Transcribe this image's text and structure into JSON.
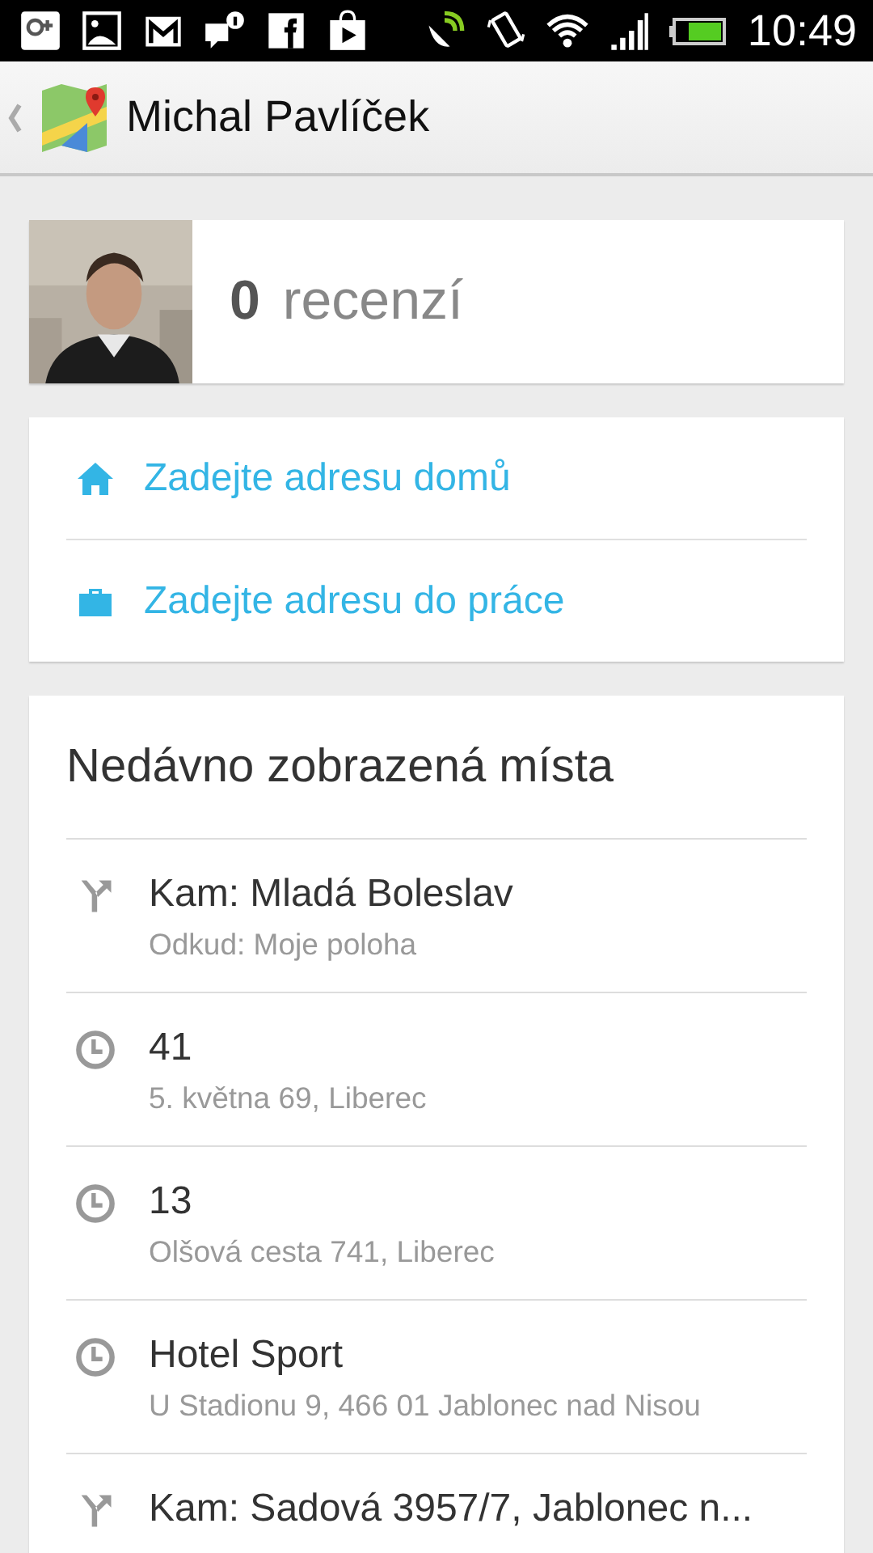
{
  "status_bar": {
    "time": "10:49"
  },
  "action_bar": {
    "title": "Michal Pavlíček"
  },
  "profile": {
    "review_count": "0",
    "review_label": "recenzí"
  },
  "address_links": [
    {
      "kind": "home",
      "label": "Zadejte adresu domů"
    },
    {
      "kind": "work",
      "label": "Zadejte adresu do práce"
    }
  ],
  "recent": {
    "heading": "Nedávno zobrazená místa",
    "items": [
      {
        "kind": "directions",
        "title": "Kam: Mladá Boleslav",
        "subtitle": "Odkud: Moje poloha"
      },
      {
        "kind": "history",
        "title": "41",
        "subtitle": "5. května 69, Liberec"
      },
      {
        "kind": "history",
        "title": "13",
        "subtitle": "Olšová cesta 741, Liberec"
      },
      {
        "kind": "history",
        "title": "Hotel Sport",
        "subtitle": "U Stadionu 9, 466 01 Jablonec nad Nisou"
      },
      {
        "kind": "directions",
        "title": "Kam: Sadová 3957/7, Jablonec n..."
      }
    ]
  }
}
